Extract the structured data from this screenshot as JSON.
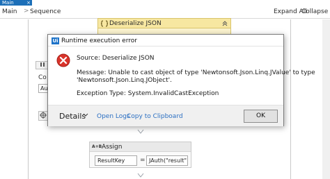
{
  "studio": {
    "doc_tab": "Main",
    "doc_tab_close": "×",
    "breadcrumb": {
      "root": "Main",
      "separator": ">",
      "current": "Sequence"
    },
    "expand_all": "Expand All",
    "collapse_all": "Collapse All",
    "left_label": "Co",
    "left_field": "Aut"
  },
  "activity": {
    "title": "Deserialize JSON",
    "icon": "json-icon",
    "collapse_icon": "chevron-up-icon"
  },
  "assign": {
    "title": "Assign",
    "icon_text": "A+B",
    "left_value": "ResultKey",
    "operator": "=",
    "right_value": "JAuth(\"result\").ToS"
  },
  "dialog": {
    "app_icon_text": "Ui",
    "title": "Runtime execution error",
    "source": "Source: Deserialize JSON",
    "message_line1": "Message: Unable to cast object of type 'Newtonsoft.Json.Linq.JValue' to type",
    "message_line2": "'Newtonsoft.Json.Linq.JObject'.",
    "exception": "Exception Type: System.InvalidCastException",
    "details_label": "Details",
    "details_chevron": "⌄",
    "open_logs": "Open Logs",
    "copy_clipboard": "Copy to Clipboard",
    "ok_label": "OK"
  },
  "colors": {
    "tab_blue": "#1c6fb8",
    "activity_yellow": "#f7e7a1",
    "error_red": "#d9342b",
    "link_blue": "#2b6fc2"
  }
}
